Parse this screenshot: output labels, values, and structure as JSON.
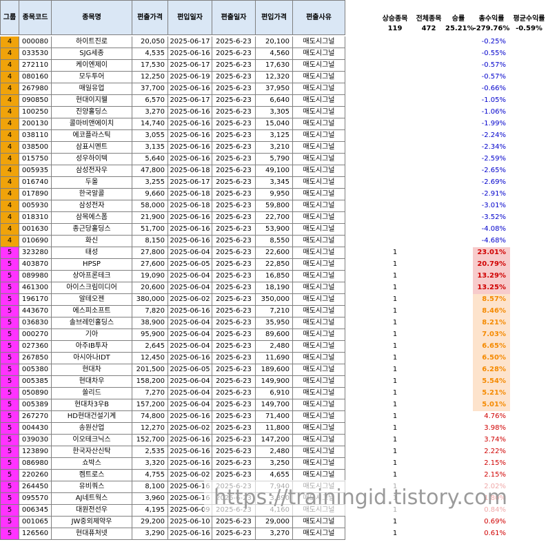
{
  "headers": {
    "group": "그룹",
    "code": "종목코드",
    "name": "종목명",
    "in_price": "편출가격",
    "in_date": "편입일자",
    "out_date": "편출일자",
    "out_price": "편입가격",
    "reason": "편출사유"
  },
  "stats": {
    "up_label": "상승종목",
    "total_label": "전체종목",
    "win_label": "승률",
    "sum_label": "총수익률",
    "avg_label": "평균수익률",
    "up_value": "119",
    "total_value": "472",
    "win_value": "25.21%",
    "sum_value": "-279.76%",
    "avg_value": "-0.59%"
  },
  "rows": [
    {
      "group": "4",
      "code": "000080",
      "name": "하이트진로",
      "p1": "20,050",
      "d1": "2025-06-17",
      "d2": "2025-6-23",
      "p2": "20,100",
      "reason": "매도시그널",
      "up": "",
      "ret": "-0.25%",
      "style": "neg"
    },
    {
      "group": "4",
      "code": "033530",
      "name": "SJG세종",
      "p1": "4,535",
      "d1": "2025-06-16",
      "d2": "2025-6-23",
      "p2": "4,560",
      "reason": "매도시그널",
      "up": "",
      "ret": "-0.55%",
      "style": "neg"
    },
    {
      "group": "4",
      "code": "272110",
      "name": "케이엔제이",
      "p1": "17,530",
      "d1": "2025-06-17",
      "d2": "2025-6-23",
      "p2": "17,630",
      "reason": "매도시그널",
      "up": "",
      "ret": "-0.57%",
      "style": "neg"
    },
    {
      "group": "4",
      "code": "080160",
      "name": "모두투어",
      "p1": "12,250",
      "d1": "2025-06-19",
      "d2": "2025-6-23",
      "p2": "12,320",
      "reason": "매도시그널",
      "up": "",
      "ret": "-0.57%",
      "style": "neg"
    },
    {
      "group": "4",
      "code": "267980",
      "name": "매일유업",
      "p1": "37,700",
      "d1": "2025-06-16",
      "d2": "2025-6-23",
      "p2": "37,950",
      "reason": "매도시그널",
      "up": "",
      "ret": "-0.66%",
      "style": "neg"
    },
    {
      "group": "4",
      "code": "090850",
      "name": "현대이지웰",
      "p1": "6,570",
      "d1": "2025-06-17",
      "d2": "2025-6-23",
      "p2": "6,640",
      "reason": "매도시그널",
      "up": "",
      "ret": "-1.05%",
      "style": "neg"
    },
    {
      "group": "4",
      "code": "100250",
      "name": "진양홀딩스",
      "p1": "3,270",
      "d1": "2025-06-16",
      "d2": "2025-6-23",
      "p2": "3,305",
      "reason": "매도시그널",
      "up": "",
      "ret": "-1.06%",
      "style": "neg"
    },
    {
      "group": "4",
      "code": "200130",
      "name": "콜마비앤에이치",
      "p1": "14,740",
      "d1": "2025-06-16",
      "d2": "2025-6-23",
      "p2": "15,040",
      "reason": "매도시그널",
      "up": "",
      "ret": "-1.99%",
      "style": "neg"
    },
    {
      "group": "4",
      "code": "038110",
      "name": "에코플라스틱",
      "p1": "3,055",
      "d1": "2025-06-16",
      "d2": "2025-6-23",
      "p2": "3,125",
      "reason": "매도시그널",
      "up": "",
      "ret": "-2.24%",
      "style": "neg"
    },
    {
      "group": "4",
      "code": "038500",
      "name": "삼표시멘트",
      "p1": "3,135",
      "d1": "2025-06-16",
      "d2": "2025-6-23",
      "p2": "3,210",
      "reason": "매도시그널",
      "up": "",
      "ret": "-2.34%",
      "style": "neg"
    },
    {
      "group": "4",
      "code": "015750",
      "name": "성우하이텍",
      "p1": "5,640",
      "d1": "2025-06-16",
      "d2": "2025-6-23",
      "p2": "5,790",
      "reason": "매도시그널",
      "up": "",
      "ret": "-2.59%",
      "style": "neg"
    },
    {
      "group": "4",
      "code": "005935",
      "name": "삼성전자우",
      "p1": "47,800",
      "d1": "2025-06-18",
      "d2": "2025-6-23",
      "p2": "49,100",
      "reason": "매도시그널",
      "up": "",
      "ret": "-2.65%",
      "style": "neg"
    },
    {
      "group": "4",
      "code": "016740",
      "name": "두올",
      "p1": "3,255",
      "d1": "2025-06-17",
      "d2": "2025-6-23",
      "p2": "3,345",
      "reason": "매도시그널",
      "up": "",
      "ret": "-2.69%",
      "style": "neg"
    },
    {
      "group": "4",
      "code": "017890",
      "name": "한국알콜",
      "p1": "9,660",
      "d1": "2025-06-18",
      "d2": "2025-6-23",
      "p2": "9,950",
      "reason": "매도시그널",
      "up": "",
      "ret": "-2.91%",
      "style": "neg"
    },
    {
      "group": "4",
      "code": "005930",
      "name": "삼성전자",
      "p1": "58,000",
      "d1": "2025-06-18",
      "d2": "2025-6-23",
      "p2": "59,800",
      "reason": "매도시그널",
      "up": "",
      "ret": "-3.01%",
      "style": "neg"
    },
    {
      "group": "4",
      "code": "018310",
      "name": "삼목에스폼",
      "p1": "21,900",
      "d1": "2025-06-16",
      "d2": "2025-6-23",
      "p2": "22,700",
      "reason": "매도시그널",
      "up": "",
      "ret": "-3.52%",
      "style": "neg"
    },
    {
      "group": "4",
      "code": "001630",
      "name": "종근당홀딩스",
      "p1": "51,700",
      "d1": "2025-06-16",
      "d2": "2025-6-23",
      "p2": "53,900",
      "reason": "매도시그널",
      "up": "",
      "ret": "-4.08%",
      "style": "neg"
    },
    {
      "group": "4",
      "code": "010690",
      "name": "화신",
      "p1": "8,150",
      "d1": "2025-06-16",
      "d2": "2025-6-23",
      "p2": "8,550",
      "reason": "매도시그널",
      "up": "",
      "ret": "-4.68%",
      "style": "neg"
    },
    {
      "group": "5",
      "code": "323280",
      "name": "태성",
      "p1": "27,800",
      "d1": "2025-06-04",
      "d2": "2025-6-23",
      "p2": "22,600",
      "reason": "매도시그널",
      "up": "1",
      "ret": "23.01%",
      "style": "pink"
    },
    {
      "group": "5",
      "code": "403870",
      "name": "HPSP",
      "p1": "27,600",
      "d1": "2025-06-05",
      "d2": "2025-6-23",
      "p2": "22,850",
      "reason": "매도시그널",
      "up": "1",
      "ret": "20.79%",
      "style": "pink"
    },
    {
      "group": "5",
      "code": "089980",
      "name": "상아프론테크",
      "p1": "19,090",
      "d1": "2025-06-04",
      "d2": "2025-6-23",
      "p2": "16,850",
      "reason": "매도시그널",
      "up": "1",
      "ret": "13.29%",
      "style": "pink"
    },
    {
      "group": "5",
      "code": "461300",
      "name": "아이스크림미디어",
      "p1": "20,600",
      "d1": "2025-06-04",
      "d2": "2025-6-23",
      "p2": "18,190",
      "reason": "매도시그널",
      "up": "1",
      "ret": "13.25%",
      "style": "pink"
    },
    {
      "group": "5",
      "code": "196170",
      "name": "알테오젠",
      "p1": "380,000",
      "d1": "2025-06-02",
      "d2": "2025-6-23",
      "p2": "350,000",
      "reason": "매도시그널",
      "up": "1",
      "ret": "8.57%",
      "style": "peach"
    },
    {
      "group": "5",
      "code": "443670",
      "name": "에스피소프트",
      "p1": "7,820",
      "d1": "2025-06-16",
      "d2": "2025-6-23",
      "p2": "7,210",
      "reason": "매도시그널",
      "up": "1",
      "ret": "8.46%",
      "style": "peach"
    },
    {
      "group": "5",
      "code": "036830",
      "name": "솔브레인홀딩스",
      "p1": "38,900",
      "d1": "2025-06-04",
      "d2": "2025-6-23",
      "p2": "35,950",
      "reason": "매도시그널",
      "up": "1",
      "ret": "8.21%",
      "style": "peach"
    },
    {
      "group": "5",
      "code": "000270",
      "name": "기아",
      "p1": "95,900",
      "d1": "2025-06-04",
      "d2": "2025-6-23",
      "p2": "89,600",
      "reason": "매도시그널",
      "up": "1",
      "ret": "7.03%",
      "style": "peach"
    },
    {
      "group": "5",
      "code": "027360",
      "name": "아주IB투자",
      "p1": "2,645",
      "d1": "2025-06-04",
      "d2": "2025-6-23",
      "p2": "2,480",
      "reason": "매도시그널",
      "up": "1",
      "ret": "6.65%",
      "style": "peach"
    },
    {
      "group": "5",
      "code": "267850",
      "name": "아시아나IDT",
      "p1": "12,450",
      "d1": "2025-06-16",
      "d2": "2025-6-23",
      "p2": "11,690",
      "reason": "매도시그널",
      "up": "1",
      "ret": "6.50%",
      "style": "peach"
    },
    {
      "group": "5",
      "code": "005380",
      "name": "현대차",
      "p1": "201,500",
      "d1": "2025-06-05",
      "d2": "2025-6-23",
      "p2": "189,600",
      "reason": "매도시그널",
      "up": "1",
      "ret": "6.28%",
      "style": "peach"
    },
    {
      "group": "5",
      "code": "005385",
      "name": "현대차우",
      "p1": "158,200",
      "d1": "2025-06-04",
      "d2": "2025-6-23",
      "p2": "149,900",
      "reason": "매도시그널",
      "up": "1",
      "ret": "5.54%",
      "style": "peach"
    },
    {
      "group": "5",
      "code": "050890",
      "name": "쏠리드",
      "p1": "7,270",
      "d1": "2025-06-04",
      "d2": "2025-6-23",
      "p2": "6,910",
      "reason": "매도시그널",
      "up": "1",
      "ret": "5.21%",
      "style": "peach"
    },
    {
      "group": "5",
      "code": "005389",
      "name": "현대차3우B",
      "p1": "157,200",
      "d1": "2025-06-04",
      "d2": "2025-6-23",
      "p2": "149,700",
      "reason": "매도시그널",
      "up": "1",
      "ret": "5.01%",
      "style": "peach"
    },
    {
      "group": "5",
      "code": "267270",
      "name": "HD현대건설기계",
      "p1": "74,800",
      "d1": "2025-06-16",
      "d2": "2025-6-23",
      "p2": "71,400",
      "reason": "매도시그널",
      "up": "1",
      "ret": "4.76%",
      "style": "pos"
    },
    {
      "group": "5",
      "code": "004430",
      "name": "송원산업",
      "p1": "12,270",
      "d1": "2025-06-02",
      "d2": "2025-6-23",
      "p2": "11,800",
      "reason": "매도시그널",
      "up": "1",
      "ret": "3.98%",
      "style": "pos"
    },
    {
      "group": "5",
      "code": "039030",
      "name": "이오테크닉스",
      "p1": "152,700",
      "d1": "2025-06-16",
      "d2": "2025-6-23",
      "p2": "147,200",
      "reason": "매도시그널",
      "up": "1",
      "ret": "3.74%",
      "style": "pos"
    },
    {
      "group": "5",
      "code": "123890",
      "name": "한국자산신탁",
      "p1": "2,535",
      "d1": "2025-06-16",
      "d2": "2025-6-23",
      "p2": "2,480",
      "reason": "매도시그널",
      "up": "1",
      "ret": "2.22%",
      "style": "pos"
    },
    {
      "group": "5",
      "code": "086980",
      "name": "쇼박스",
      "p1": "3,320",
      "d1": "2025-06-16",
      "d2": "2025-6-23",
      "p2": "3,250",
      "reason": "매도시그널",
      "up": "1",
      "ret": "2.15%",
      "style": "pos"
    },
    {
      "group": "5",
      "code": "220260",
      "name": "켐트로스",
      "p1": "4,755",
      "d1": "2025-06-02",
      "d2": "2025-6-23",
      "p2": "4,655",
      "reason": "매도시그널",
      "up": "1",
      "ret": "2.15%",
      "style": "pos"
    },
    {
      "group": "5",
      "code": "264450",
      "name": "유비쿼스",
      "p1": "8,100",
      "d1": "2025-06-16",
      "d2": "2025-6-23",
      "p2": "7,940",
      "reason": "매도시그널",
      "up": "1",
      "ret": "2.02%",
      "style": "pos"
    },
    {
      "group": "5",
      "code": "095570",
      "name": "AJ네트웍스",
      "p1": "3,960",
      "d1": "2025-06-16",
      "d2": "2025-6-23",
      "p2": "3,890",
      "reason": "매도시그널",
      "up": "1",
      "ret": "1.80%",
      "style": "pos"
    },
    {
      "group": "5",
      "code": "006345",
      "name": "대원전선우",
      "p1": "4,195",
      "d1": "2025-06-09",
      "d2": "2025-6-23",
      "p2": "4,160",
      "reason": "매도시그널",
      "up": "1",
      "ret": "0.84%",
      "style": "pos"
    },
    {
      "group": "5",
      "code": "001065",
      "name": "JW중외제약우",
      "p1": "29,200",
      "d1": "2025-06-10",
      "d2": "2025-6-23",
      "p2": "29,000",
      "reason": "매도시그널",
      "up": "1",
      "ret": "0.69%",
      "style": "pos"
    },
    {
      "group": "5",
      "code": "126560",
      "name": "현대퓨처넷",
      "p1": "3,290",
      "d1": "2025-06-16",
      "d2": "2025-6-23",
      "p2": "3,270",
      "reason": "매도시그널",
      "up": "1",
      "ret": "0.61%",
      "style": "pos"
    }
  ],
  "watermark": "https://trainingid.tistory.com"
}
